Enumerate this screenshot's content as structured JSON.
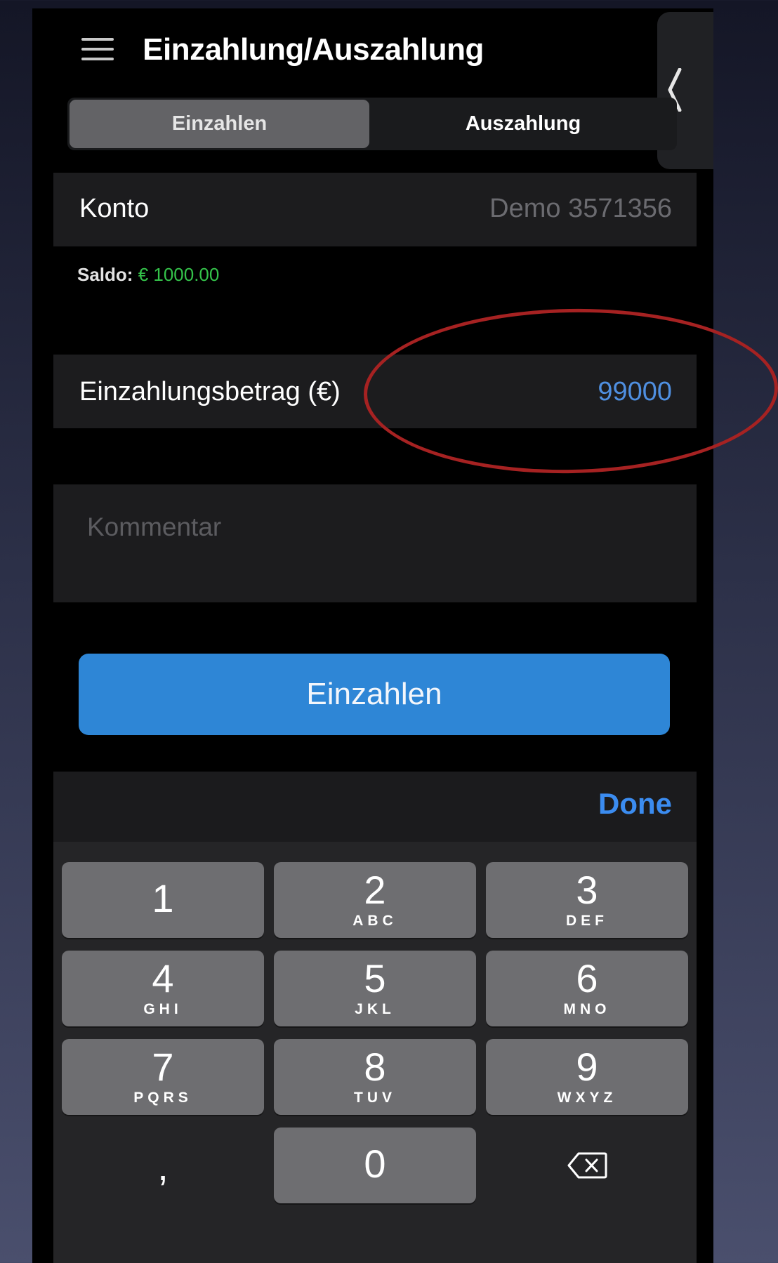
{
  "header": {
    "title": "Einzahlung/Auszahlung",
    "menu_icon": "hamburger-menu-icon",
    "side_panel_icon": "chevron-left-icon"
  },
  "tabs": [
    {
      "label": "Einzahlen",
      "active": true
    },
    {
      "label": "Auszahlung",
      "active": false
    }
  ],
  "account": {
    "label": "Konto",
    "value": "Demo 3571356"
  },
  "balance": {
    "label": "Saldo:",
    "value": "€ 1000.00"
  },
  "deposit": {
    "label": "Einzahlungsbetrag (€)",
    "value": "99000"
  },
  "comment": {
    "placeholder": "Kommentar"
  },
  "submit_label": "Einzahlen",
  "keyboard": {
    "done_label": "Done",
    "keys": [
      {
        "digit": "1",
        "letters": ""
      },
      {
        "digit": "2",
        "letters": "ABC"
      },
      {
        "digit": "3",
        "letters": "DEF"
      },
      {
        "digit": "4",
        "letters": "GHI"
      },
      {
        "digit": "5",
        "letters": "JKL"
      },
      {
        "digit": "6",
        "letters": "MNO"
      },
      {
        "digit": "7",
        "letters": "PQRS"
      },
      {
        "digit": "8",
        "letters": "TUV"
      },
      {
        "digit": "9",
        "letters": "WXYZ"
      },
      {
        "digit": ",",
        "letters": ""
      },
      {
        "digit": "0",
        "letters": ""
      }
    ],
    "backspace_icon": "backspace-icon"
  },
  "colors": {
    "accent_blue": "#2e86d6",
    "link_blue": "#3b8cf0",
    "balance_green": "#34c24a",
    "annotation_red": "#a62222"
  }
}
